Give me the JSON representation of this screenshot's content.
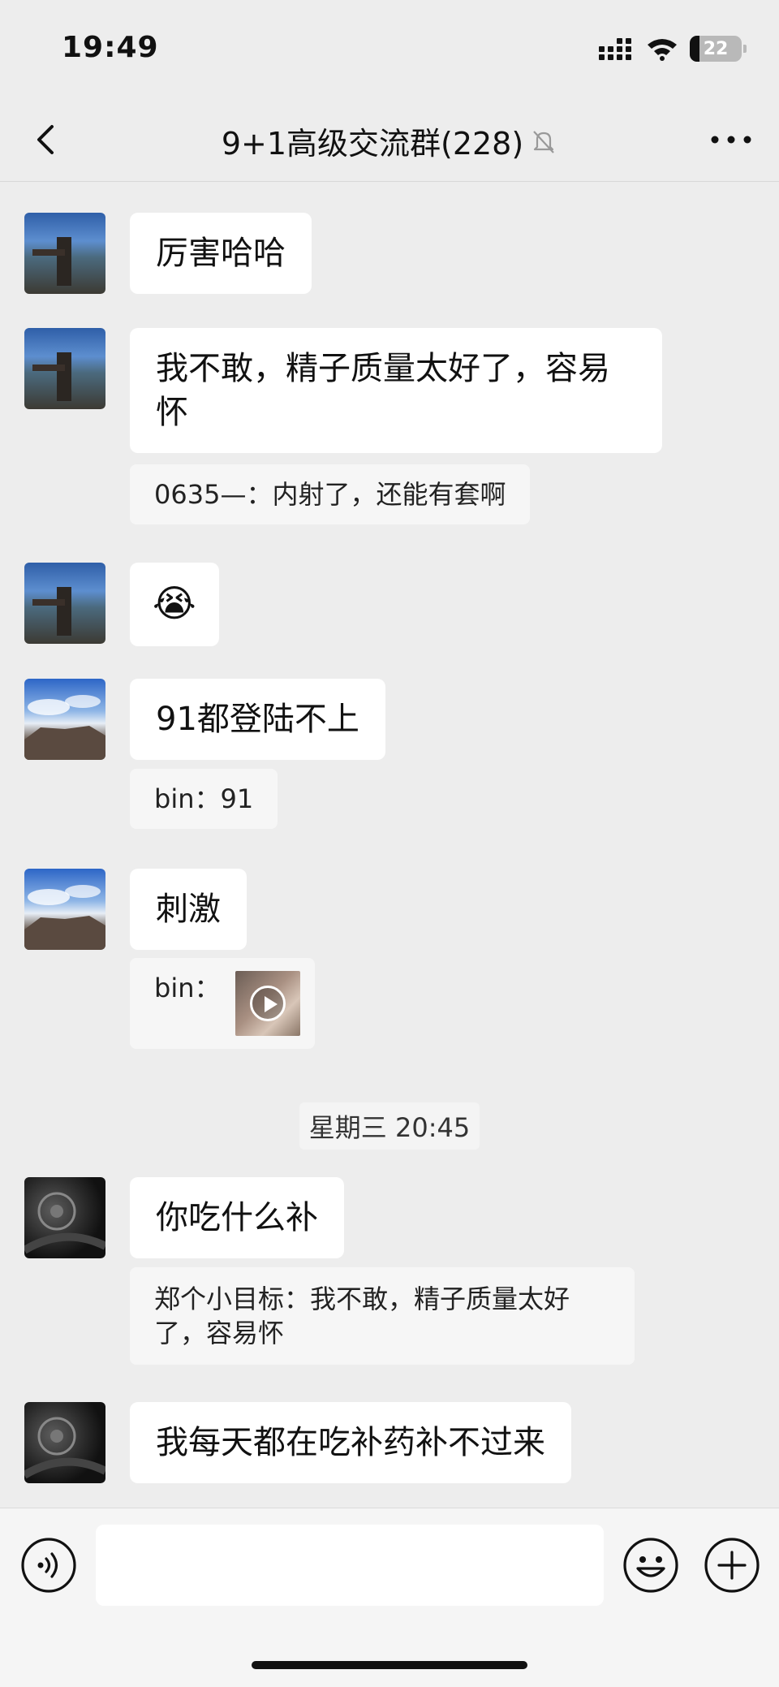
{
  "status_bar": {
    "time": "19:49",
    "battery": "22"
  },
  "nav": {
    "title": "9+1高级交流群(228)"
  },
  "messages": [
    {
      "text": "厉害哈哈"
    },
    {
      "text": "我不敢，精子质量太好了，容易怀",
      "line1": "我不敢，精子质量太好了，容易",
      "line2": "怀",
      "quote": "0635—：内射了，还能有套啊"
    },
    {
      "text": "😭"
    },
    {
      "text": "91都登陆不上",
      "quote": "bin：91"
    },
    {
      "text": "刺激",
      "quote": "bin："
    },
    {
      "text": "你吃什么补",
      "quote": "郑个小目标：我不敢，精子质量太好了，容易怀",
      "quote_line1": "郑个小目标：我不敢，精子质量太好",
      "quote_line2": "了，容易怀"
    },
    {
      "text": "我每天都在吃补药补不过来"
    }
  ],
  "time_divider": "星期三 20:45",
  "icons": {
    "back": "chevron-left-icon",
    "mute": "bell-slash-icon",
    "more": "more-dots-icon",
    "voice": "voice-icon",
    "emoji": "emoji-icon",
    "add": "plus-icon",
    "video_play": "play-icon"
  }
}
